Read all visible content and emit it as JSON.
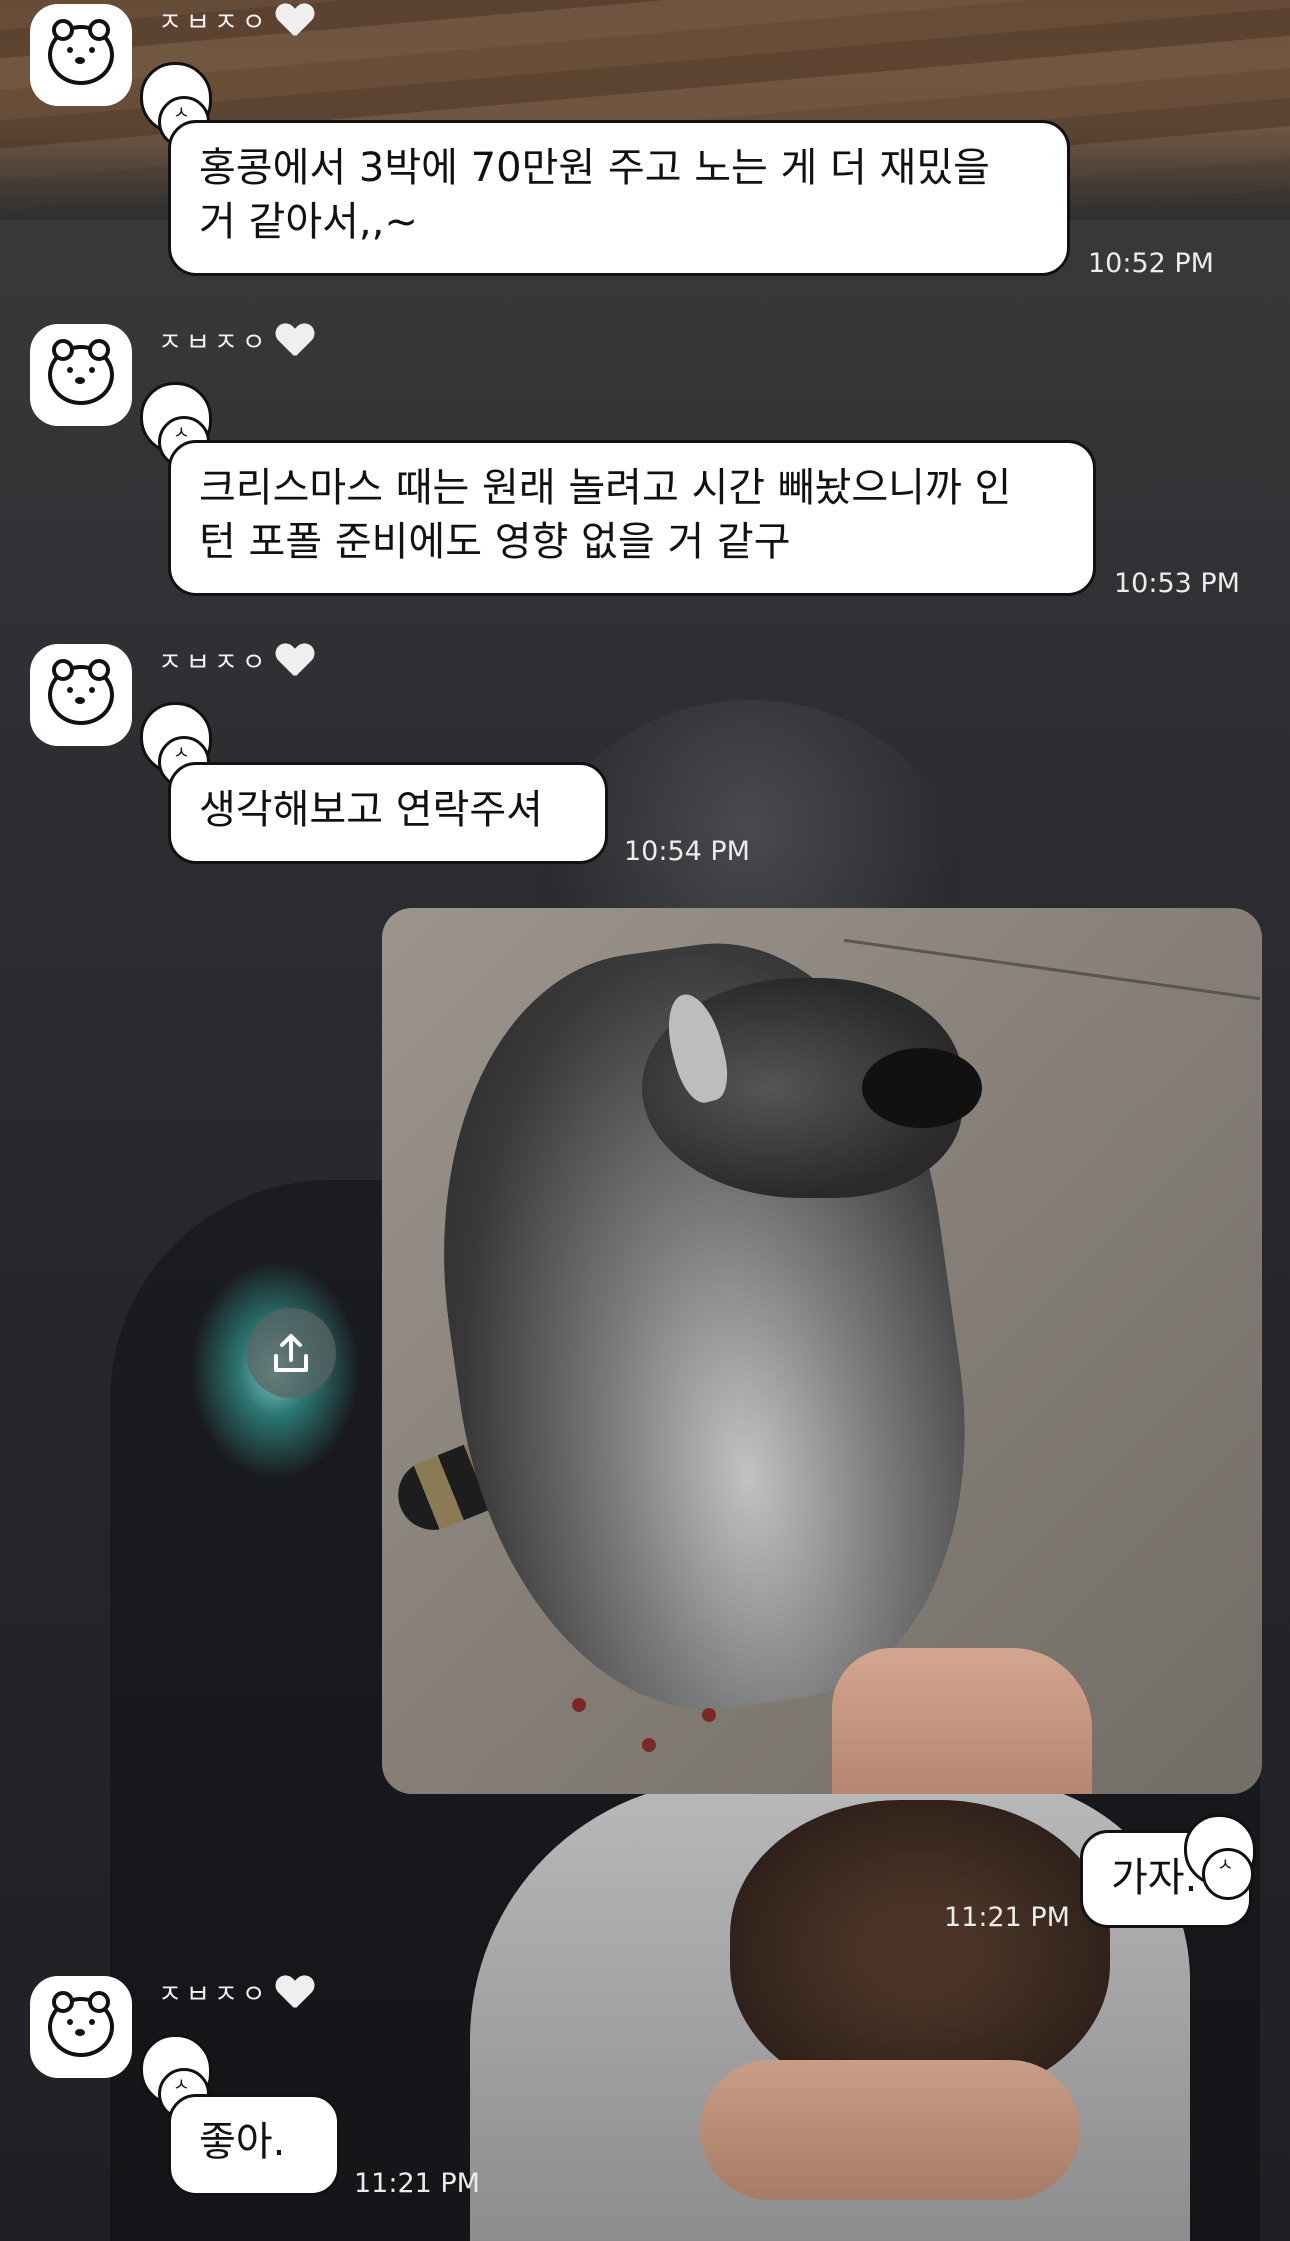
{
  "chat": {
    "messages": [
      {
        "sender": "ㅈㅂㅈㅇ",
        "text": "홍콩에서 3박에 70만원 주고 노는 게 더 재밌을\n거 같아서,,~",
        "time": "10:52 PM"
      },
      {
        "sender": "ㅈㅂㅈㅇ",
        "text": "크리스마스 때는 원래 놀려고 시간 빼놨으니까 인\n턴 포폴 준비에도 영향 없을 거 같구",
        "time": "10:53 PM"
      },
      {
        "sender": "ㅈㅂㅈㅇ",
        "text": "생각해보고 연락주셔",
        "time": "10:54 PM"
      },
      {
        "sender": "me",
        "text": "가자.",
        "time": "11:21 PM"
      },
      {
        "sender": "ㅈㅂㅈㅇ",
        "text": "좋아.",
        "time": "11:21 PM"
      }
    ],
    "shared_photo": {
      "subject": "raccoon-photo"
    },
    "icons": {
      "share": "share-icon",
      "heart": "heart-icon",
      "avatar": "bear-avatar-icon",
      "sticker": "bear-sticker-icon"
    }
  }
}
